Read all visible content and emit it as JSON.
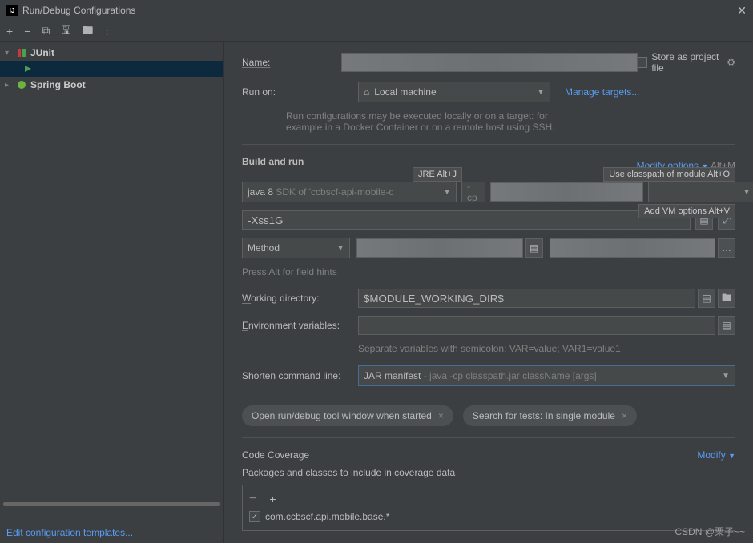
{
  "window": {
    "title": "Run/Debug Configurations"
  },
  "tree": {
    "junit": "JUnit",
    "spring": "Spring Boot"
  },
  "sidebar": {
    "edit_templates": "Edit configuration templates..."
  },
  "form": {
    "name_label": "Name:",
    "store_label": "Store as project file",
    "runon_label": "Run on:",
    "runon_value": "Local machine",
    "manage_targets": "Manage targets...",
    "runon_hint1": "Run configurations may be executed locally or on a target: for",
    "runon_hint2": "example in a Docker Container or on a remote host using SSH.",
    "build_title": "Build and run",
    "modify_options": "Modify options",
    "modify_shortcut": "Alt+M",
    "jre_hint": "JRE Alt+J",
    "classpath_hint": "Use classpath of module Alt+O",
    "vmoptions_hint": "Add VM options Alt+V",
    "java_label": "java 8",
    "java_sdk": "SDK of 'ccbscf-api-mobile-c",
    "cp_value": "-cp",
    "vm_value": "-Xss1G",
    "method_label": "Method",
    "alt_hints": "Press Alt for field hints",
    "workdir_label": "Working directory:",
    "workdir_value": "$MODULE_WORKING_DIR$",
    "env_label": "Environment variables:",
    "env_hint": "Separate variables with semicolon: VAR=value; VAR1=value1",
    "shorten_label": "Shorten command line:",
    "shorten_value": "JAR manifest",
    "shorten_detail": " - java -cp classpath.jar className [args]",
    "chip1": "Open run/debug tool window when started",
    "chip2": "Search for tests: In single module",
    "coverage_title": "Code Coverage",
    "modify_label": "Modify",
    "coverage_sub": "Packages and classes to include in coverage data",
    "cov_pkg": "com.ccbscf.api.mobile.base.*"
  },
  "watermark": "CSDN @栗子~~"
}
